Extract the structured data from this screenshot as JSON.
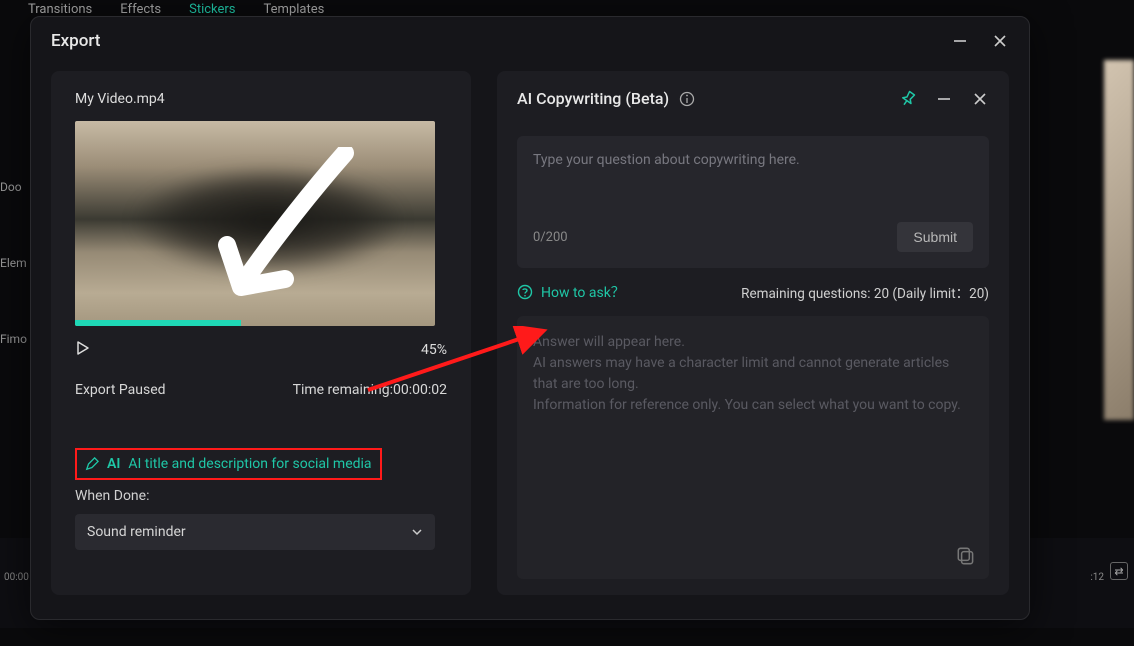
{
  "bg_menu": {
    "transitions": "Transitions",
    "effects": "Effects",
    "stickers": "Stickers",
    "templates": "Templates"
  },
  "bg_sidebar": {
    "doo": "Doo",
    "elem": "Elem",
    "fimo": "Fimo"
  },
  "timeline": {
    "left_tc": "00:00",
    "right_tc": ":12"
  },
  "export": {
    "title": "Export",
    "filename": "My Video.mp4",
    "progress_percent": "45%",
    "status": "Export Paused",
    "time_remaining_label": "Time remaining:",
    "time_remaining_value": "00:00:02",
    "ai_link": "AI title and description for social media",
    "when_done_label": "When Done:",
    "dropdown_value": "Sound reminder"
  },
  "ai_panel": {
    "title": "AI Copywriting (Beta)",
    "placeholder": "Type your question about copywriting here.",
    "char_count": "0/200",
    "submit": "Submit",
    "how_to_ask": "How to ask？",
    "remaining": "Remaining questions: 20 (Daily limit：20)",
    "answer_placeholder_1": "Answer will appear here.",
    "answer_placeholder_2": "AI answers may have a character limit and cannot generate articles that are too long.",
    "answer_placeholder_3": "Information for reference only. You can select what you want to copy."
  }
}
